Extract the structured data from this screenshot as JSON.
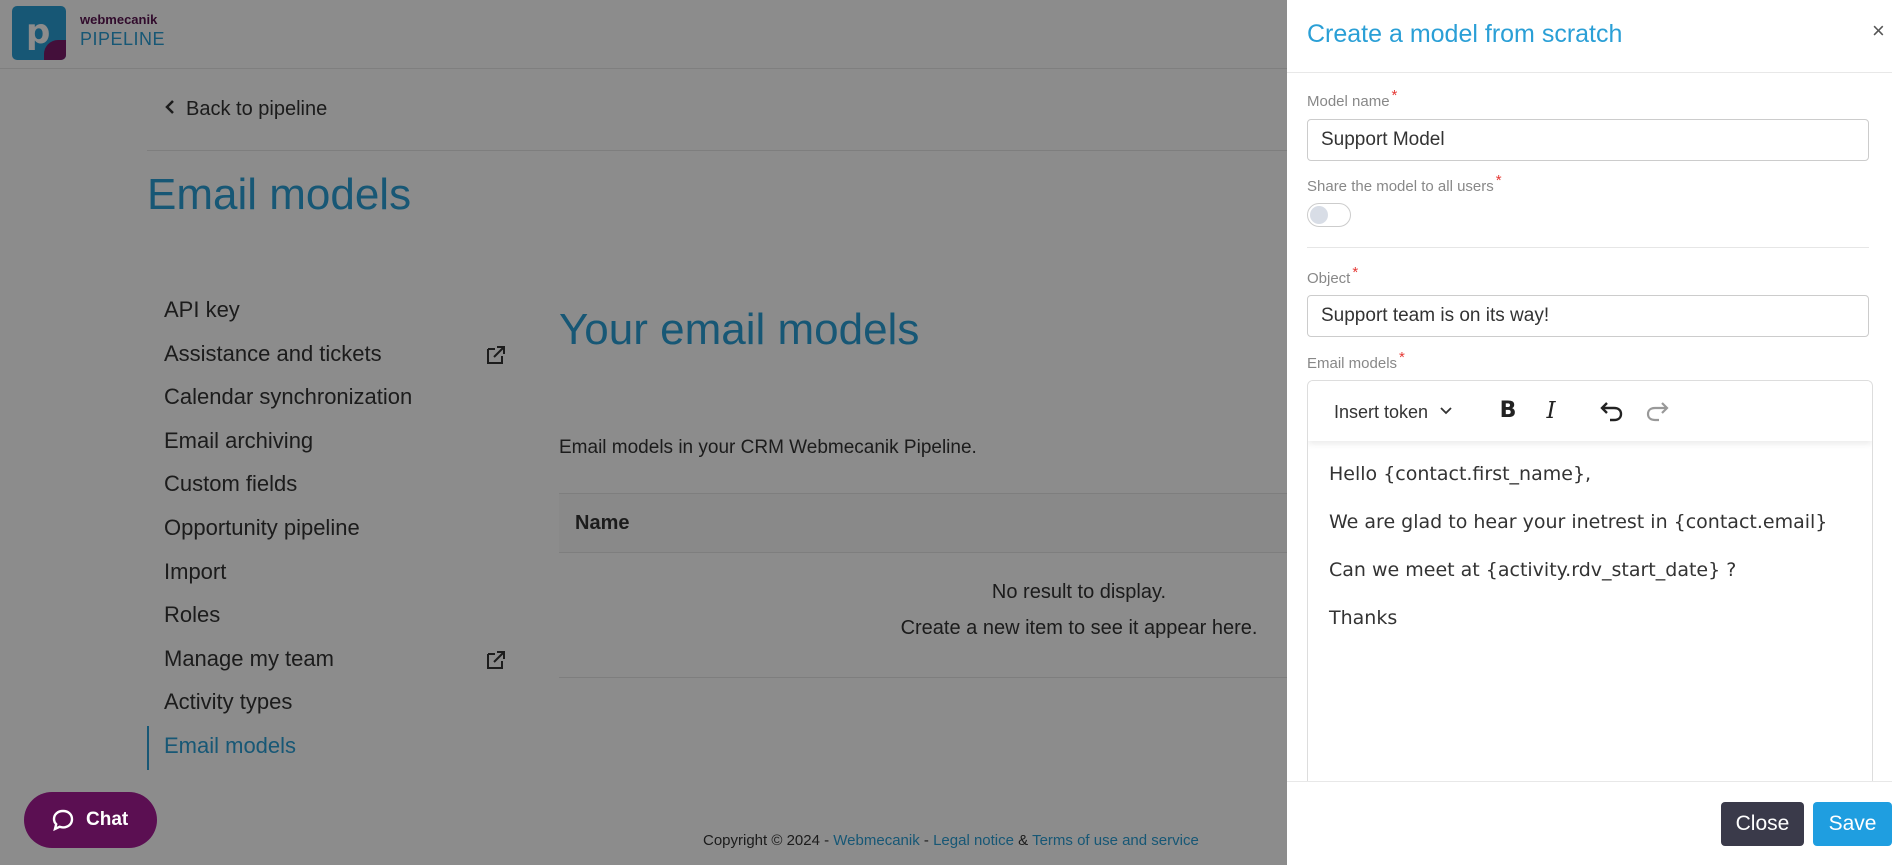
{
  "brand": {
    "top": "webmecanik",
    "bottom": "PIPELINE",
    "logo_letter": "p"
  },
  "header": {
    "back_label": "Back to pipeline",
    "page_title": "Email models"
  },
  "sidebar": {
    "items": [
      {
        "label": "API key"
      },
      {
        "label": "Assistance and tickets"
      },
      {
        "label": "Calendar synchronization"
      },
      {
        "label": "Email archiving"
      },
      {
        "label": "Custom fields"
      },
      {
        "label": "Opportunity pipeline"
      },
      {
        "label": "Import"
      },
      {
        "label": "Roles"
      },
      {
        "label": "Manage my team"
      },
      {
        "label": "Activity types"
      },
      {
        "label": "Email models"
      }
    ]
  },
  "main": {
    "section_title": "Your email models",
    "description": "Email models in your CRM Webmecanik Pipeline.",
    "table_header_name": "Name",
    "empty_line1": "No result to display.",
    "empty_line2": "Create a new item to see it appear here."
  },
  "footer": {
    "prefix": "Copyright © 2024 - ",
    "link1": "Webmecanik",
    "sep1": " - ",
    "link2": "Legal notice",
    "sep2": " & ",
    "link3": "Terms of use and service"
  },
  "chat": {
    "label": "Chat"
  },
  "drawer": {
    "title": "Create a model from scratch",
    "close_symbol": "×",
    "required_mark": "*",
    "model_name_label": "Model name",
    "model_name_value": "Support Model",
    "share_label": "Share the model to all users",
    "share_enabled": false,
    "object_label": "Object",
    "object_value": "Support team is on its way!",
    "email_models_label": "Email models",
    "toolbar": {
      "insert_token": "Insert token",
      "bold": "B",
      "italic": "I"
    },
    "body_lines": [
      "Hello {contact.first_name},",
      "We are glad to hear your inetrest in {contact.email}",
      "Can we meet at {activity.rdv_start_date} ?",
      "Thanks"
    ],
    "close_button": "Close",
    "save_button": "Save"
  },
  "colors": {
    "accent": "#2a9fd6",
    "brand_purple": "#5b0f52",
    "dark_button": "#3a3a4a",
    "save_button": "#1f9ee0"
  }
}
